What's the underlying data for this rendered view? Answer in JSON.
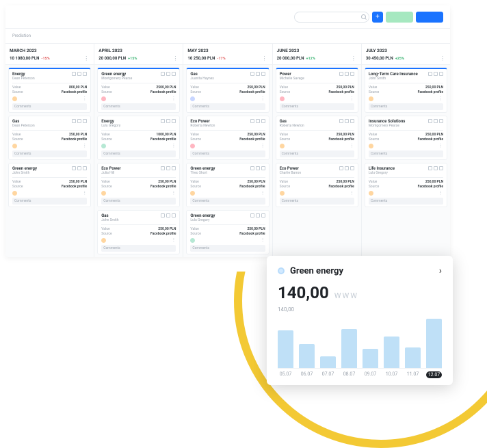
{
  "tab": "Prediction",
  "labels": {
    "value": "Value",
    "source": "Source",
    "comments": "Comments",
    "src": "Facebook profile"
  },
  "columns": [
    {
      "month": "MARCH 2023",
      "sum": "10 1080,00 PLN",
      "pct": "-15%",
      "dir": "neg",
      "cards": [
        {
          "t": "Energy",
          "p": "Dean Peterson",
          "v": "800,00 PLN",
          "hi": true,
          "av": ""
        },
        {
          "t": "Gas",
          "p": "Dean Peterson",
          "v": "250,00 PLN",
          "av": ""
        },
        {
          "t": "Green energy",
          "p": "John Smith",
          "v": "250,00 PLN",
          "av": ""
        }
      ]
    },
    {
      "month": "APRIL 2023",
      "sum": "20 000,00 PLN",
      "pct": "+15%",
      "dir": "pos",
      "cards": [
        {
          "t": "Green energy",
          "p": "Montgomery Pearse",
          "v": "2500,00 PLN",
          "hi": true,
          "av": "b"
        },
        {
          "t": "Energy",
          "p": "Lulu Gregory",
          "v": "1000,00 PLN",
          "av": "c"
        },
        {
          "t": "Eco Power",
          "p": "Julia Hill",
          "v": "250,00 PLN",
          "av": ""
        },
        {
          "t": "Gas",
          "p": "John Smith",
          "v": "250,00 PLN",
          "av": ""
        }
      ]
    },
    {
      "month": "MAY 2023",
      "sum": "10 250,00 PLN",
      "pct": "-17%",
      "dir": "neg",
      "cards": [
        {
          "t": "Gas",
          "p": "Juanita Haynes",
          "v": "250,00 PLN",
          "hi": true,
          "av": "d"
        },
        {
          "t": "Eco Power",
          "p": "Roberta Newton",
          "v": "250,00 PLN",
          "av": "b"
        },
        {
          "t": "Green energy",
          "p": "Theo Short",
          "v": "250,00 PLN",
          "av": ""
        },
        {
          "t": "Green energy",
          "p": "Lulu Gregory",
          "v": "250,00 PLN",
          "av": "c"
        }
      ]
    },
    {
      "month": "JUNE 2023",
      "sum": "20 000,00 PLN",
      "pct": "+12%",
      "dir": "pos",
      "cards": [
        {
          "t": "Power",
          "p": "Michelle Savage",
          "v": "250,00 PLN",
          "hi": true,
          "av": "b"
        },
        {
          "t": "Gas",
          "p": "Roberta Newton",
          "v": "250,00 PLN",
          "av": ""
        },
        {
          "t": "Eco Power",
          "p": "Charlie Barron",
          "v": "250,00 PLN",
          "av": ""
        }
      ]
    },
    {
      "month": "JULY 2023",
      "sum": "30 450,00 PLN",
      "pct": "+25%",
      "dir": "pos",
      "cards": [
        {
          "t": "Long-Term Care Insurance",
          "p": "John Smith",
          "v": "250,00 PLN",
          "hi": true,
          "av": ""
        },
        {
          "t": "Insurance Solutions",
          "p": "Montgomery Pearse",
          "v": "250,00 PLN",
          "av": ""
        },
        {
          "t": "Life Insurance",
          "p": "Lulu Gregory",
          "v": "250,00 PLN",
          "av": ""
        }
      ]
    }
  ],
  "chart_data": {
    "type": "bar",
    "title": "Green energy",
    "value": "140,00",
    "currency": "WWW",
    "ylabel": "140,00",
    "categories": [
      "05.07",
      "06.07",
      "07.07",
      "08.07",
      "09.07",
      "10.07",
      "11.07",
      "12.07"
    ],
    "values": [
      60,
      38,
      18,
      62,
      30,
      50,
      32,
      78
    ],
    "ylim": [
      0,
      80
    ],
    "active_index": 7
  }
}
